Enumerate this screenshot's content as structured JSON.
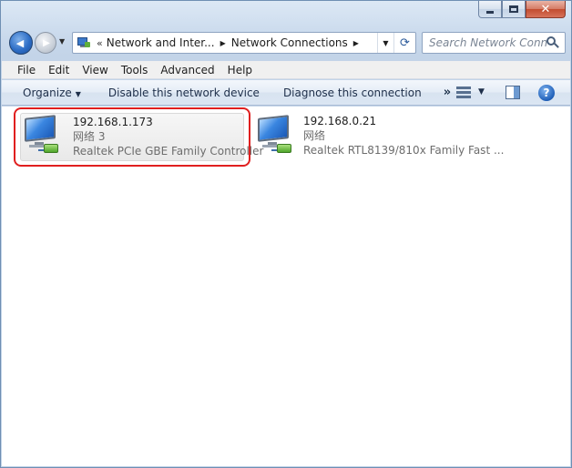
{
  "window": {
    "caption": {
      "minimize": "—",
      "maximize": "□",
      "close": "✕"
    }
  },
  "nav": {
    "back_glyph": "◀",
    "forward_glyph": "▶",
    "address": {
      "overflow": "«",
      "crumbs": [
        "Network and Inter...",
        "Network Connections"
      ],
      "separator": "▶"
    },
    "search_placeholder": "Search Network Conn..."
  },
  "menu": [
    "File",
    "Edit",
    "View",
    "Tools",
    "Advanced",
    "Help"
  ],
  "commands": {
    "organize": "Organize",
    "disable": "Disable this network device",
    "diagnose": "Diagnose this connection",
    "more": "»"
  },
  "connections": [
    {
      "name": "192.168.1.173",
      "status": "网络  3",
      "device": "Realtek PCIe GBE Family Controller",
      "selected": true,
      "icon": "network-adapter-icon"
    },
    {
      "name": "192.168.0.21",
      "status": "网络",
      "device": "Realtek RTL8139/810x Family Fast ...",
      "selected": false,
      "icon": "network-adapter-icon"
    }
  ],
  "colors": {
    "highlight_border": "#e01f1f",
    "command_text": "#1e2f4a"
  }
}
